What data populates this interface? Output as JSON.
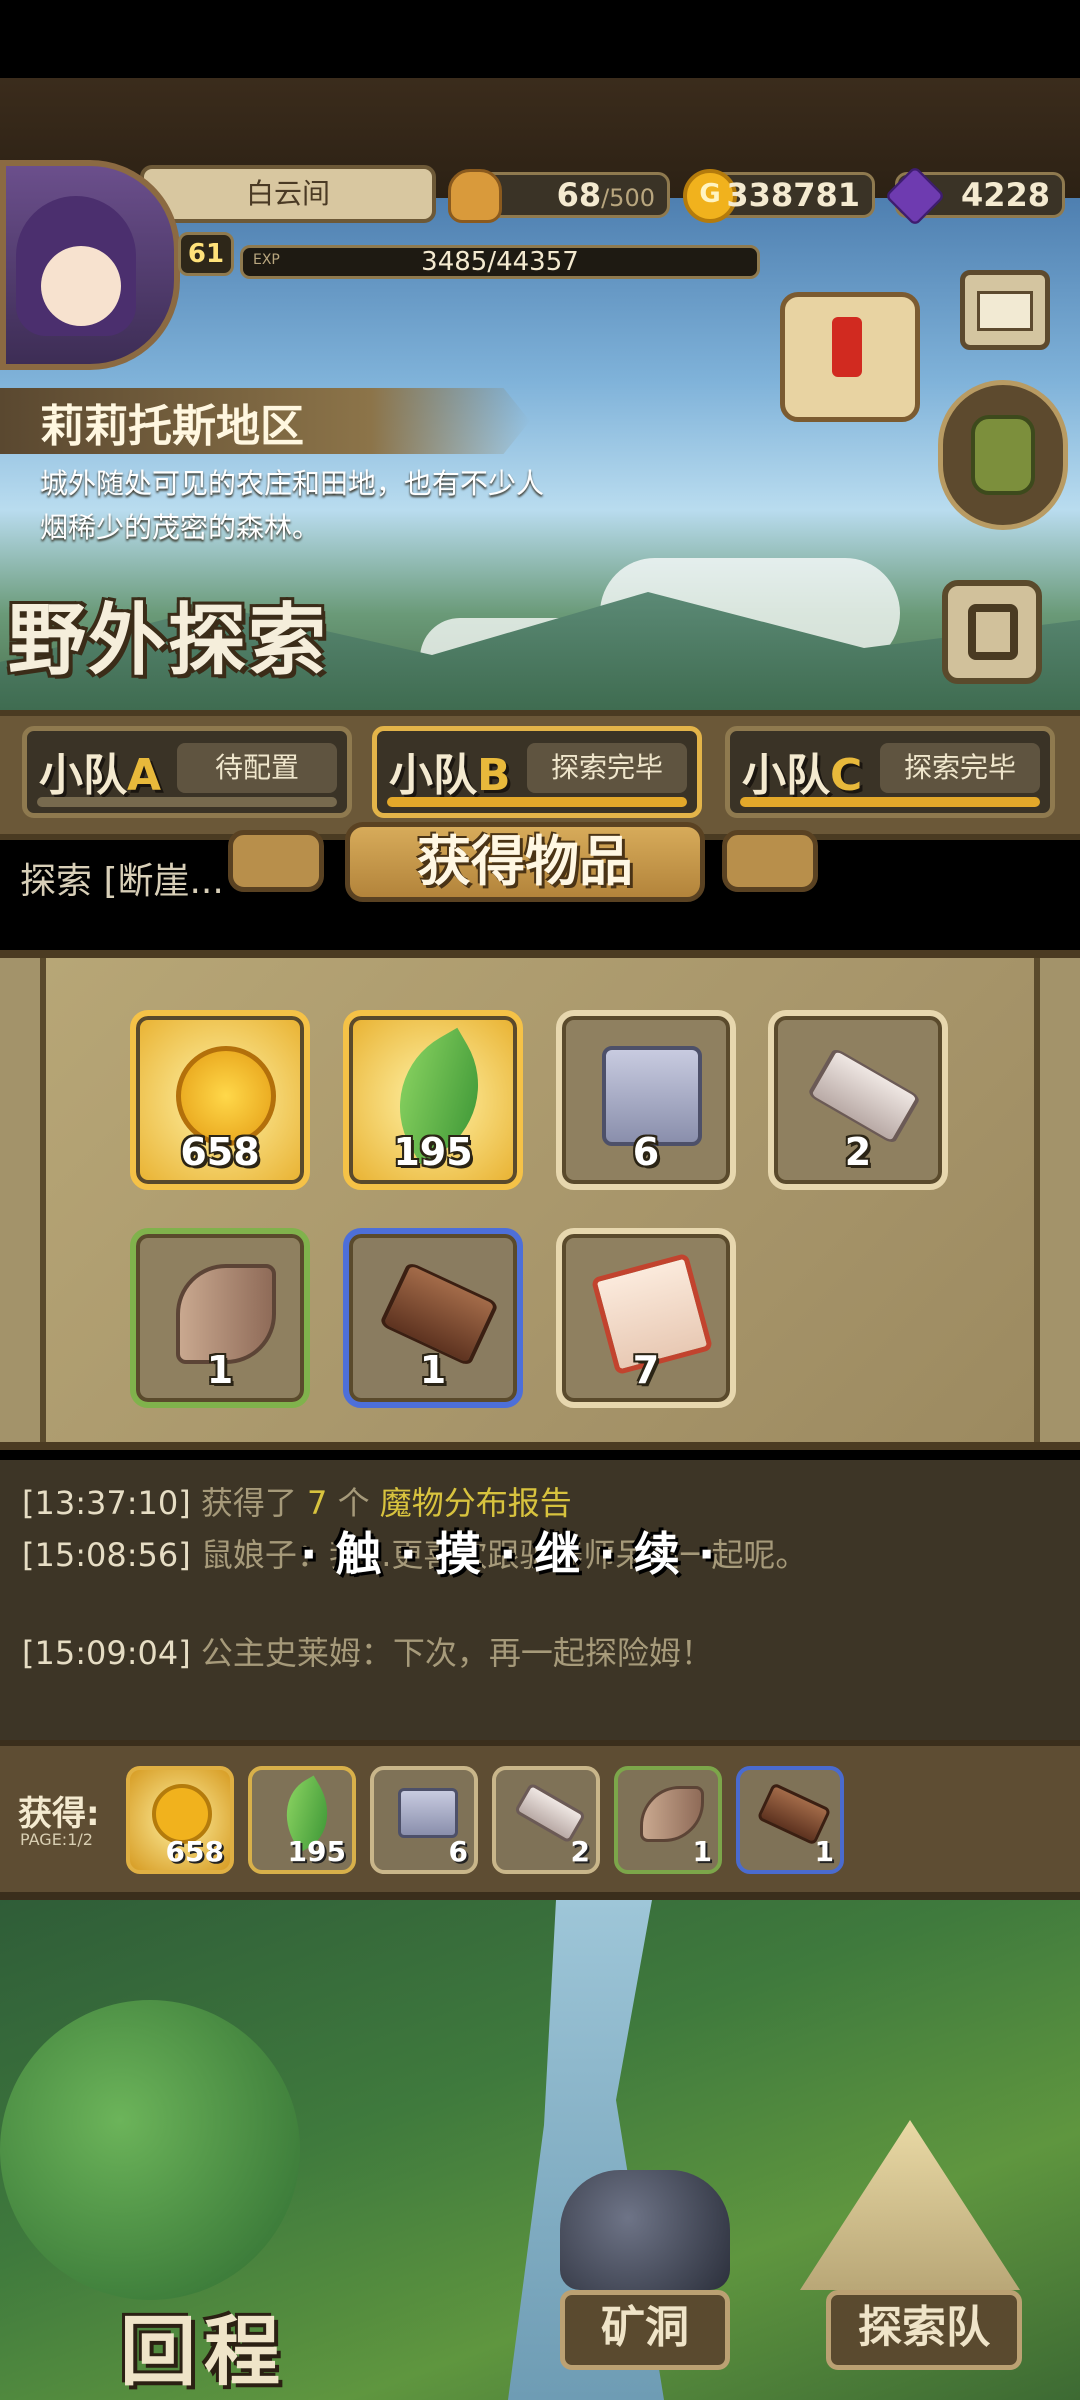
{
  "header": {
    "player_name": "白云间",
    "level": "61",
    "exp_label": "EXP",
    "exp_text": "3485/44357",
    "stamina": "68",
    "stamina_max": "/500",
    "gold": "338781",
    "gems": "4228"
  },
  "region": {
    "name": "莉莉托斯地区",
    "description": "城外随处可见的农庄和田地，也有不少人烟稀少的茂密的森林。"
  },
  "screen_title": "野外探索",
  "squads": [
    {
      "name": "小队",
      "letter": "A",
      "status": "待配置"
    },
    {
      "name": "小队",
      "letter": "B",
      "status": "探索完毕"
    },
    {
      "name": "小队",
      "letter": "C",
      "status": "探索完毕"
    }
  ],
  "explore_line": "探索 [断崖...",
  "modal": {
    "title": "获得物品",
    "items": [
      {
        "count": "658",
        "icon": "gold-coin-icon"
      },
      {
        "count": "195",
        "icon": "feather-icon"
      },
      {
        "count": "6",
        "icon": "stone-blocks-icon"
      },
      {
        "count": "2",
        "icon": "stone-slab-icon"
      },
      {
        "count": "1",
        "icon": "horn-icon"
      },
      {
        "count": "1",
        "icon": "wood-plank-icon"
      },
      {
        "count": "7",
        "icon": "scroll-icon"
      }
    ]
  },
  "log": {
    "line1_ts": "[13:37:10]",
    "line1_text": "获得了",
    "line1_count": "7",
    "line1_unit": "个",
    "line1_item": "魔物分布报告",
    "line2_ts": "[15:08:56]",
    "line2_text": "鼠娘子：我...更喜欢跟驯养师呆在一起呢。",
    "line3_ts": "[15:09:04]",
    "line3_text": "公主史莱姆：下次，再一起探险姆！",
    "touch_prompt": "·触·摸·继·续·"
  },
  "obtained": {
    "label": "获得:",
    "page": "PAGE:1/2",
    "items": [
      {
        "count": "658",
        "icon": "gold-coin-icon"
      },
      {
        "count": "195",
        "icon": "feather-icon"
      },
      {
        "count": "6",
        "icon": "stone-blocks-icon"
      },
      {
        "count": "2",
        "icon": "stone-slab-icon"
      },
      {
        "count": "1",
        "icon": "horn-icon"
      },
      {
        "count": "1",
        "icon": "wood-plank-icon"
      }
    ]
  },
  "bottom_nav": {
    "return_label": "回程",
    "mine_label": "矿洞",
    "team_label": "探索队"
  }
}
